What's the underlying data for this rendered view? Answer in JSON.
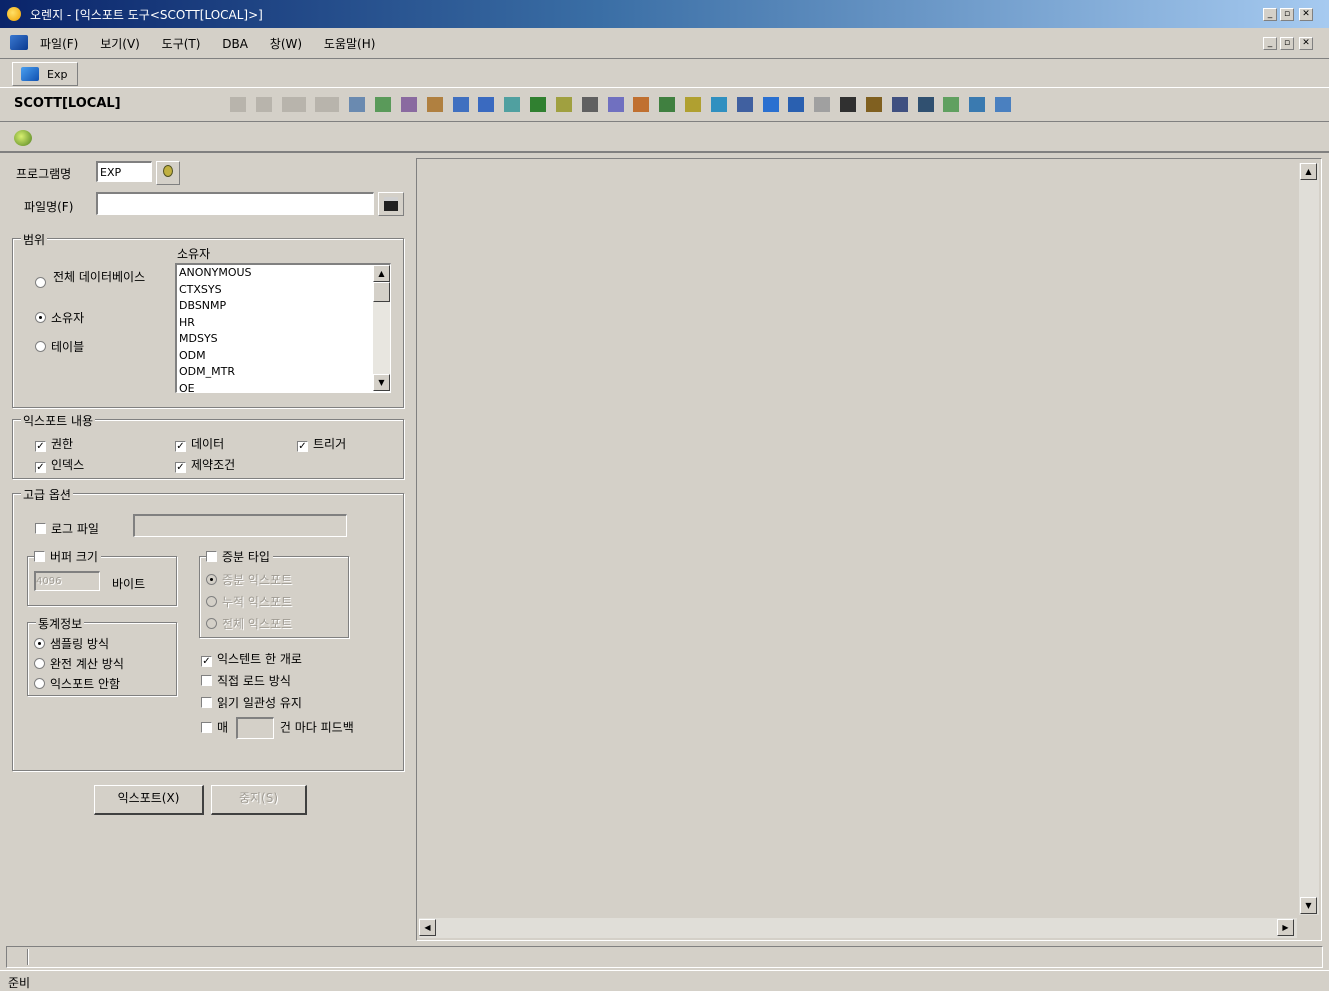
{
  "window": {
    "title": "오렌지 - [익스포트 도구<SCOTT[LOCAL]>]"
  },
  "menu": [
    "파일(F)",
    "보기(V)",
    "도구(T)",
    "DBA",
    "창(W)",
    "도움말(H)"
  ],
  "tab": {
    "label": "Exp"
  },
  "connection": {
    "label": "SCOTT[LOCAL]"
  },
  "form": {
    "program_label": "프로그램명",
    "program_value": "EXP",
    "file_label": "파일명(F)",
    "file_value": ""
  },
  "scope": {
    "legend": "범위",
    "owner_label": "소유자",
    "options": [
      "전체 데이터베이스",
      "소유자",
      "테이블"
    ],
    "owners": [
      "ANONYMOUS",
      "CTXSYS",
      "DBSNMP",
      "HR",
      "MDSYS",
      "ODM",
      "ODM_MTR",
      "OE"
    ]
  },
  "export_content": {
    "legend": "익스포트 내용",
    "privileges": "권한",
    "data": "데이터",
    "triggers": "트리거",
    "indexes": "인덱스",
    "constraints": "제약조건"
  },
  "advanced": {
    "legend": "고급 옵션",
    "log_file": "로그 파일",
    "buffer_size": "버퍼 크기",
    "buffer_value": "4096",
    "bytes": "바이트",
    "incremental": "증분 타입",
    "incremental_options": [
      "증분 익스포트",
      "누적 익스포트",
      "전체 익스포트"
    ],
    "statistics_legend": "통계정보",
    "statistics_options": [
      "샘플링 방식",
      "완전 계산 방식",
      "익스포트 안함"
    ],
    "compress": "익스텐트 한 개로",
    "direct": "직접 로드 방식",
    "consistent": "읽기 일관성 유지",
    "feedback_prefix": "매",
    "feedback_suffix": "건 마다 피드백"
  },
  "buttons": {
    "export": "익스포트(X)",
    "stop": "중지(S)"
  },
  "status": {
    "text": "준비"
  }
}
